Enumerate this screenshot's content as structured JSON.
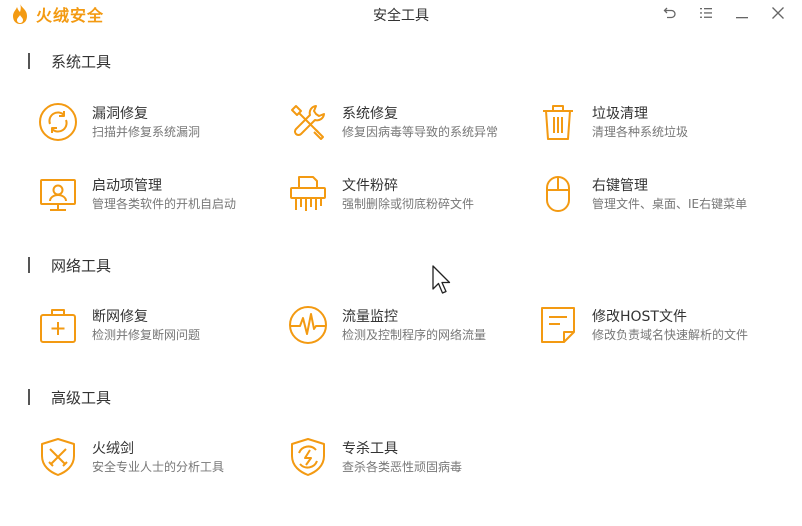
{
  "app": {
    "brand": "火绒安全",
    "window_title": "安全工具",
    "controls": [
      {
        "name": "back-icon"
      },
      {
        "name": "menu-icon"
      },
      {
        "name": "minimize-icon"
      },
      {
        "name": "close-icon"
      }
    ]
  },
  "sections": [
    {
      "title": "系统工具",
      "tools": [
        {
          "name": "漏洞修复",
          "desc": "扫描并修复系统漏洞",
          "icon": "refresh-circle-icon"
        },
        {
          "name": "系统修复",
          "desc": "修复因病毒等导致的系统异常",
          "icon": "wrench-screwdriver-icon"
        },
        {
          "name": "垃圾清理",
          "desc": "清理各种系统垃圾",
          "icon": "trash-icon"
        },
        {
          "name": "启动项管理",
          "desc": "管理各类软件的开机自启动",
          "icon": "monitor-icon"
        },
        {
          "name": "文件粉碎",
          "desc": "强制删除或彻底粉碎文件",
          "icon": "shredder-icon"
        },
        {
          "name": "右键管理",
          "desc": "管理文件、桌面、IE右键菜单",
          "icon": "mouse-icon"
        }
      ]
    },
    {
      "title": "网络工具",
      "tools": [
        {
          "name": "断网修复",
          "desc": "检测并修复断网问题",
          "icon": "first-aid-kit-icon"
        },
        {
          "name": "流量监控",
          "desc": "检测及控制程序的网络流量",
          "icon": "pulse-monitor-icon"
        },
        {
          "name": "修改HOST文件",
          "desc": "修改负责域名快速解析的文件",
          "icon": "document-icon"
        }
      ]
    },
    {
      "title": "高级工具",
      "tools": [
        {
          "name": "火绒剑",
          "desc": "安全专业人士的分析工具",
          "icon": "shield-swords-icon"
        },
        {
          "name": "专杀工具",
          "desc": "查杀各类恶性顽固病毒",
          "icon": "shield-bolt-icon"
        }
      ]
    }
  ],
  "colors": {
    "accent": "#f39a12",
    "text": "#333333",
    "subtext": "#777777"
  }
}
